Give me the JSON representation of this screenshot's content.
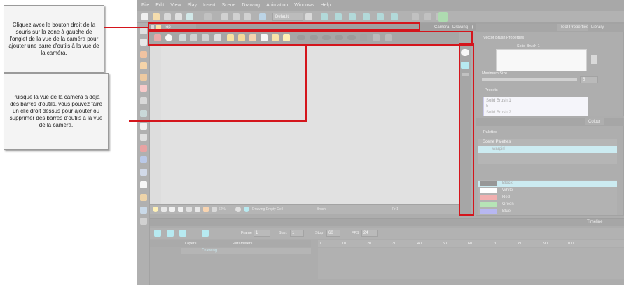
{
  "callouts": {
    "first": "Cliquez avec le bouton droit de la souris sur la zone à gauche de l'onglet de la vue de la caméra pour ajouter une barre d'outils à la vue de la caméra.",
    "second": "Puisque la vue de la caméra a déjà des barres d'outils, vous pouvez faire un clic droit dessus pour ajouter ou supprimer des barres d'outils à la vue de la caméra."
  },
  "menubar": [
    "File",
    "Edit",
    "View",
    "Play",
    "Insert",
    "Scene",
    "Drawing",
    "Animation",
    "Windows",
    "Help"
  ],
  "toolbar": {
    "workspace_select": "Default"
  },
  "camera_view": {
    "tab_label": "Top",
    "tabs_right": [
      "Camera",
      "Drawing"
    ],
    "status": {
      "zoom": "62%",
      "drawing": "Drawing Empty Cell",
      "brush": "Brush",
      "frame": "Fr 1"
    }
  },
  "tool_properties": {
    "tabs": [
      "Tool Properties",
      "Library"
    ],
    "title": "Vector Brush Properties",
    "brush_name": "Solid Brush 1",
    "max_size_label": "Maximum Size",
    "max_size_value": "5",
    "presets_label": "Presets",
    "preset_name": "Solid Brush 1",
    "preset_size": "5",
    "preset_second": "Solid Brush 2"
  },
  "colour": {
    "tab": "Colour",
    "palettes_label": "Palettes",
    "scene_palettes": "Scene Palettes",
    "palette_item": "wargirl",
    "swatches": [
      {
        "name": "Black",
        "color": "#1a1a1a"
      },
      {
        "name": "White",
        "color": "#ffffff"
      },
      {
        "name": "Red",
        "color": "#e05050"
      },
      {
        "name": "Green",
        "color": "#5ec45e"
      },
      {
        "name": "Blue",
        "color": "#6060e0"
      }
    ]
  },
  "timeline": {
    "tab": "Timeline",
    "frame_label": "Frame",
    "frame_value": "1",
    "start_label": "Start",
    "start_value": "1",
    "stop_label": "Stop",
    "stop_value": "60",
    "fps_label": "FPS",
    "fps_value": "24",
    "layers_label": "Layers",
    "parameters_label": "Parameters",
    "layer_name": "Drawing",
    "ruler": [
      "1",
      "10",
      "20",
      "30",
      "40",
      "50",
      "60",
      "70",
      "80",
      "90",
      "100"
    ]
  },
  "colors": {
    "highlight": "#d4151c",
    "selection": "#8fd2e0"
  }
}
